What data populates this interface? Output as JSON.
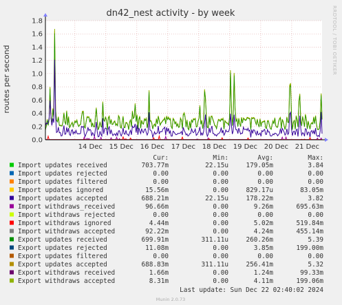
{
  "chart_data": {
    "type": "line",
    "title": "dn42_nest activity - by week",
    "ylabel": "routes per second",
    "watermark": "RRDTOOL / TOBI OETIKER",
    "ylim": [
      0,
      1.8
    ],
    "yticks": [
      "0.0",
      "0.2",
      "0.4",
      "0.6",
      "0.8",
      "1.0",
      "1.2",
      "1.4",
      "1.6",
      "1.8"
    ],
    "xticks": [
      "14 Dec",
      "15 Dec",
      "16 Dec",
      "17 Dec",
      "18 Dec",
      "19 Dec",
      "20 Dec",
      "21 Dec"
    ],
    "x_range_days": [
      13.05,
      21.98
    ],
    "peaks": [
      {
        "series": "Export withdraws accepted",
        "x": 13.35,
        "y": 1.68
      },
      {
        "series": "Export withdraws accepted",
        "x": 13.2,
        "y": 0.8
      },
      {
        "series": "Export withdraws accepted",
        "x": 18.2,
        "y": 1.0
      },
      {
        "series": "Export withdraws accepted",
        "x": 19.02,
        "y": 1.07
      },
      {
        "series": "Export withdraws accepted",
        "x": 19.15,
        "y": 1.1
      },
      {
        "series": "Export withdraws accepted",
        "x": 20.95,
        "y": 1.2
      },
      {
        "series": "Export withdraws accepted",
        "x": 21.25,
        "y": 0.92
      },
      {
        "series": "Export withdraws accepted",
        "x": 21.95,
        "y": 0.7
      },
      {
        "series": "Export withdraws accepted",
        "x": 16.4,
        "y": 0.78
      },
      {
        "series": "Export withdraws accepted",
        "x": 14.9,
        "y": 0.58
      }
    ],
    "legend_header": {
      "cur": "Cur:",
      "min": "Min:",
      "avg": "Avg:",
      "max": "Max:"
    },
    "series": [
      {
        "name": "Import updates received",
        "color": "#00cc00",
        "cur": "703.77m",
        "min": "22.15u",
        "avg": "179.05m",
        "max": "3.84"
      },
      {
        "name": "Import updates rejected",
        "color": "#0066b3",
        "cur": "0.00",
        "min": "0.00",
        "avg": "0.00",
        "max": "0.00"
      },
      {
        "name": "Import updates filtered",
        "color": "#ff8000",
        "cur": "0.00",
        "min": "0.00",
        "avg": "0.00",
        "max": "0.00"
      },
      {
        "name": "Import updates ignored",
        "color": "#ffcc00",
        "cur": "15.56m",
        "min": "0.00",
        "avg": "829.17u",
        "max": "83.05m"
      },
      {
        "name": "Import updates accepted",
        "color": "#330099",
        "cur": "688.21m",
        "min": "22.15u",
        "avg": "178.22m",
        "max": "3.82"
      },
      {
        "name": "Import withdraws_received",
        "color": "#990099",
        "cur": "96.66m",
        "min": "0.00",
        "avg": "9.26m",
        "max": "695.63m"
      },
      {
        "name": "Import withdraws rejected",
        "color": "#ccff00",
        "cur": "0.00",
        "min": "0.00",
        "avg": "0.00",
        "max": "0.00"
      },
      {
        "name": "Import withdraws ignored",
        "color": "#ff0000",
        "cur": "4.44m",
        "min": "0.00",
        "avg": "5.02m",
        "max": "519.84m"
      },
      {
        "name": "Import withdraws accepted",
        "color": "#808080",
        "cur": "92.22m",
        "min": "0.00",
        "avg": "4.24m",
        "max": "455.14m"
      },
      {
        "name": "Export updates received",
        "color": "#008f00",
        "cur": "699.91m",
        "min": "311.11u",
        "avg": "260.26m",
        "max": "5.39"
      },
      {
        "name": "Export updates rejected",
        "color": "#00487d",
        "cur": "11.08m",
        "min": "0.00",
        "avg": "3.85m",
        "max": "199.00m"
      },
      {
        "name": "Export updates filtered",
        "color": "#b35a00",
        "cur": "0.00",
        "min": "0.00",
        "avg": "0.00",
        "max": "0.00"
      },
      {
        "name": "Export updates accepted",
        "color": "#b38f00",
        "cur": "688.83m",
        "min": "311.11u",
        "avg": "256.41m",
        "max": "5.32"
      },
      {
        "name": "Export withdraws received",
        "color": "#6b006b",
        "cur": "1.66m",
        "min": "0.00",
        "avg": "1.24m",
        "max": "99.33m"
      },
      {
        "name": "Export withdraws accepted",
        "color": "#8fb300",
        "cur": "8.31m",
        "min": "0.00",
        "avg": "4.11m",
        "max": "199.06m"
      }
    ],
    "last_update": "Last update: Sun Dec 22 02:40:02 2024",
    "footer": "Munin 2.0.73",
    "grid": true
  }
}
